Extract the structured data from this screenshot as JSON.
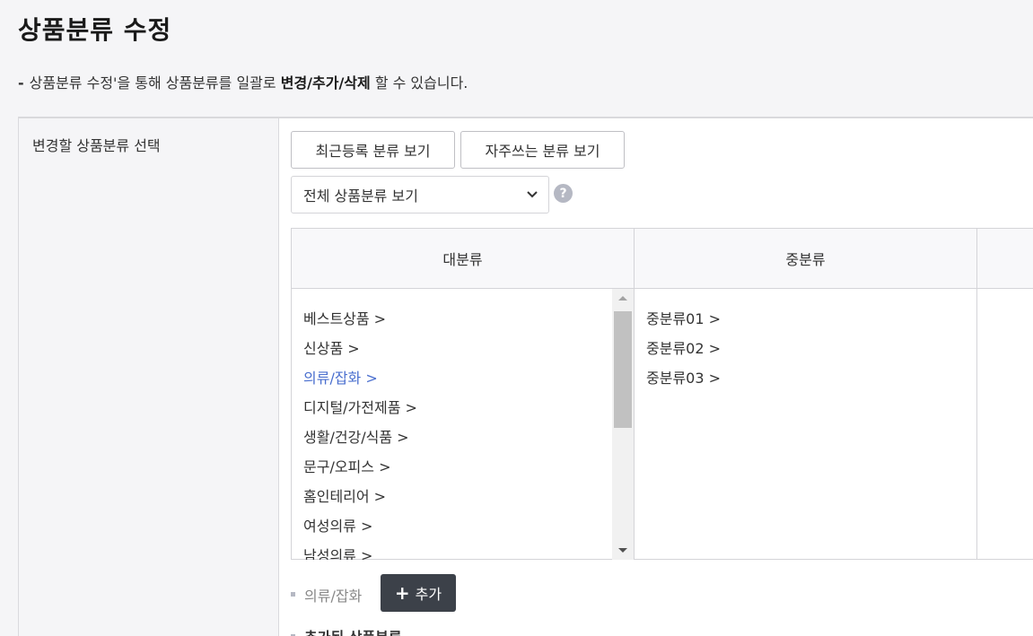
{
  "page": {
    "title": "상품분류 수정",
    "desc_dash": "-",
    "desc_prefix": "상품분류 수정'을 통해 상품분류를 일괄로 ",
    "desc_bold": "변경/추가/삭제",
    "desc_suffix": " 할 수 있습니다."
  },
  "form": {
    "label": "변경할 상품분류 선택",
    "recent_button": "최근등록 분류 보기",
    "frequent_button": "자주쓰는 분류 보기",
    "select_value": "전체 상품분류 보기",
    "help_icon": "?"
  },
  "columns": {
    "large_header": "대분류",
    "medium_header": "중분류",
    "large_items": [
      {
        "label": "베스트상품 >"
      },
      {
        "label": "신상품 >"
      },
      {
        "label": "의류/잡화 >"
      },
      {
        "label": "디지털/가전제품 >"
      },
      {
        "label": "생활/건강/식품 >"
      },
      {
        "label": "문구/오피스 >"
      },
      {
        "label": "홈인테리어 >"
      },
      {
        "label": "여성의류 >"
      },
      {
        "label": "남성의류 >"
      }
    ],
    "medium_items": [
      {
        "label": "중분류01 >"
      },
      {
        "label": "중분류02 >"
      },
      {
        "label": "중분류03 >"
      }
    ],
    "active_item": "의류/잡화 >"
  },
  "selection": {
    "selected_text": "의류/잡화",
    "add_plus": "+",
    "add_label": "추가",
    "added_label": "추가된 상품분류"
  },
  "colors": {
    "active_link": "#4a6fcf",
    "add_button_bg": "#3c4149",
    "page_bg": "#f5f5f7"
  }
}
